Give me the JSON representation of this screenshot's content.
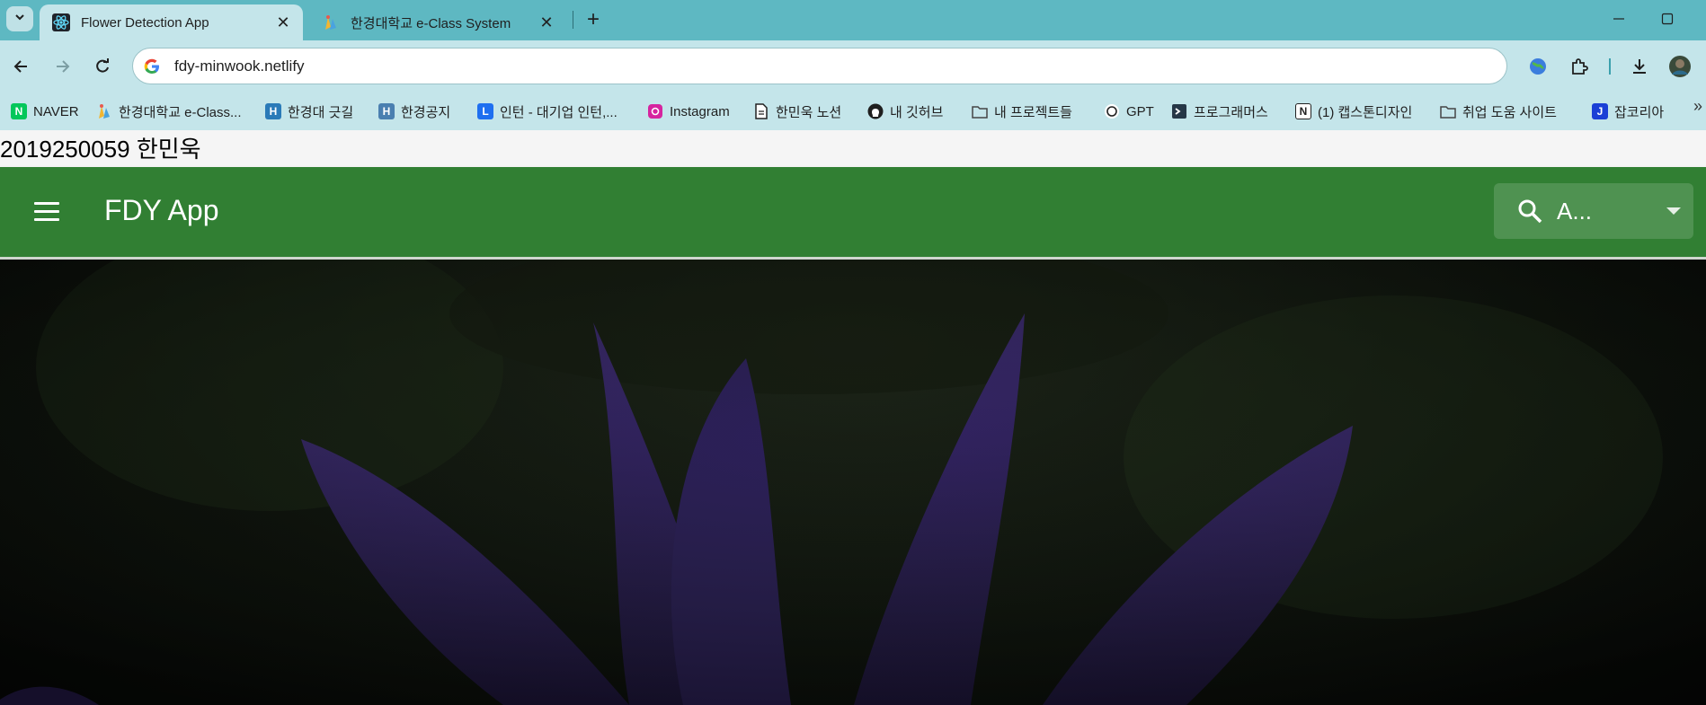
{
  "browser": {
    "tabs": [
      {
        "title": "Flower Detection App",
        "active": true,
        "favicon": "react-icon"
      },
      {
        "title": "한경대학교 e-Class System",
        "active": false,
        "favicon": "eclass-icon"
      }
    ],
    "url": "fdy-minwook.netlify",
    "bookmarks": [
      {
        "label": "NAVER",
        "icon": "naver-icon",
        "color": "#03c75a",
        "glyph": "N"
      },
      {
        "label": "한경대학교 e-Class...",
        "icon": "eclass-icon",
        "color": "#f2b632",
        "glyph": ""
      },
      {
        "label": "한경대 긋길",
        "icon": "hk-icon",
        "color": "#2a7ab8",
        "glyph": "H"
      },
      {
        "label": "한경공지",
        "icon": "hk-notice-icon",
        "color": "#4a7fb0",
        "glyph": "H"
      },
      {
        "label": "인턴 - 대기업 인턴,...",
        "icon": "linkareer-icon",
        "color": "#1e6ff0",
        "glyph": "L"
      },
      {
        "label": "Instagram",
        "icon": "instagram-icon",
        "color": "#d6249f",
        "glyph": ""
      },
      {
        "label": "한민욱 노션",
        "icon": "document-icon",
        "color": "#ffffff",
        "glyph": ""
      },
      {
        "label": "내 깃허브",
        "icon": "github-icon",
        "color": "#1f1f1f",
        "glyph": ""
      },
      {
        "label": "내 프로젝트들",
        "icon": "folder-icon",
        "color": "#ffffff",
        "glyph": ""
      },
      {
        "label": "GPT",
        "icon": "openai-icon",
        "color": "#ffffff",
        "glyph": ""
      },
      {
        "label": "프로그래머스",
        "icon": "programmers-icon",
        "color": "#263747",
        "glyph": ""
      },
      {
        "label": "(1) 캡스톤디자인",
        "icon": "notion-icon",
        "color": "#ffffff",
        "glyph": "N"
      },
      {
        "label": "취업 도움 사이트",
        "icon": "folder-icon",
        "color": "#ffffff",
        "glyph": ""
      },
      {
        "label": "잡코리아",
        "icon": "jobkorea-icon",
        "color": "#1b3fd6",
        "glyph": "J"
      }
    ]
  },
  "page": {
    "student_line": "2019250059 한민욱",
    "app_title": "FDY App",
    "search_value": "A...",
    "accent_color": "#317f33"
  }
}
